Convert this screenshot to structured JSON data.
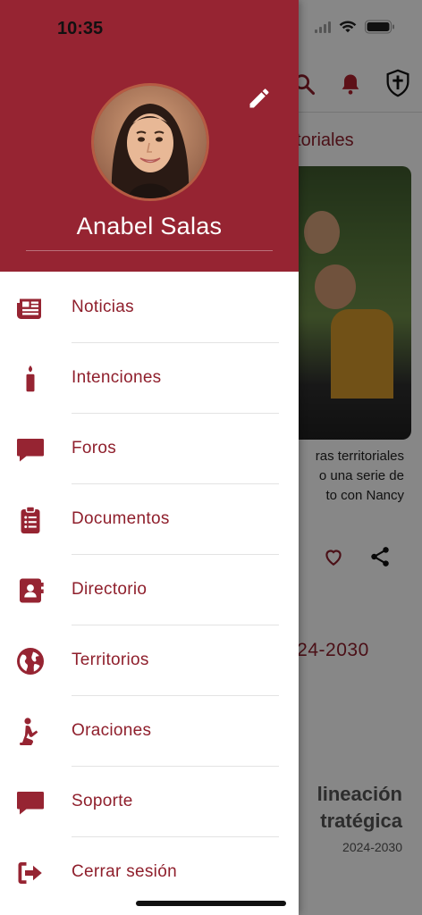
{
  "status_bar": {
    "time": "10:35"
  },
  "drawer": {
    "user_name": "Anabel Salas",
    "menu": [
      {
        "id": "noticias",
        "label": "Noticias",
        "icon": "newspaper-icon"
      },
      {
        "id": "intenciones",
        "label": "Intenciones",
        "icon": "candle-icon"
      },
      {
        "id": "foros",
        "label": "Foros",
        "icon": "chat-bubble-icon"
      },
      {
        "id": "documentos",
        "label": "Documentos",
        "icon": "clipboard-list-icon"
      },
      {
        "id": "directorio",
        "label": "Directorio",
        "icon": "contact-book-icon"
      },
      {
        "id": "territorios",
        "label": "Territorios",
        "icon": "globe-icon"
      },
      {
        "id": "oraciones",
        "label": "Oraciones",
        "icon": "praying-person-icon"
      },
      {
        "id": "soporte",
        "label": "Soporte",
        "icon": "chat-bubble-icon"
      },
      {
        "id": "cerrar",
        "label": "Cerrar sesión",
        "icon": "logout-icon"
      }
    ]
  },
  "background": {
    "section_title": "ritoriales",
    "excerpt_lines": [
      "ras territoriales",
      "o una serie de",
      "to con Nancy"
    ],
    "year_title": "024-2030",
    "banner_line1": "lineación",
    "banner_line2": "tratégica",
    "banner_year": "2024-2030"
  },
  "colors": {
    "brand": "#962432",
    "text_accent": "#8f1f2c",
    "divider": "#e3e3e3"
  }
}
